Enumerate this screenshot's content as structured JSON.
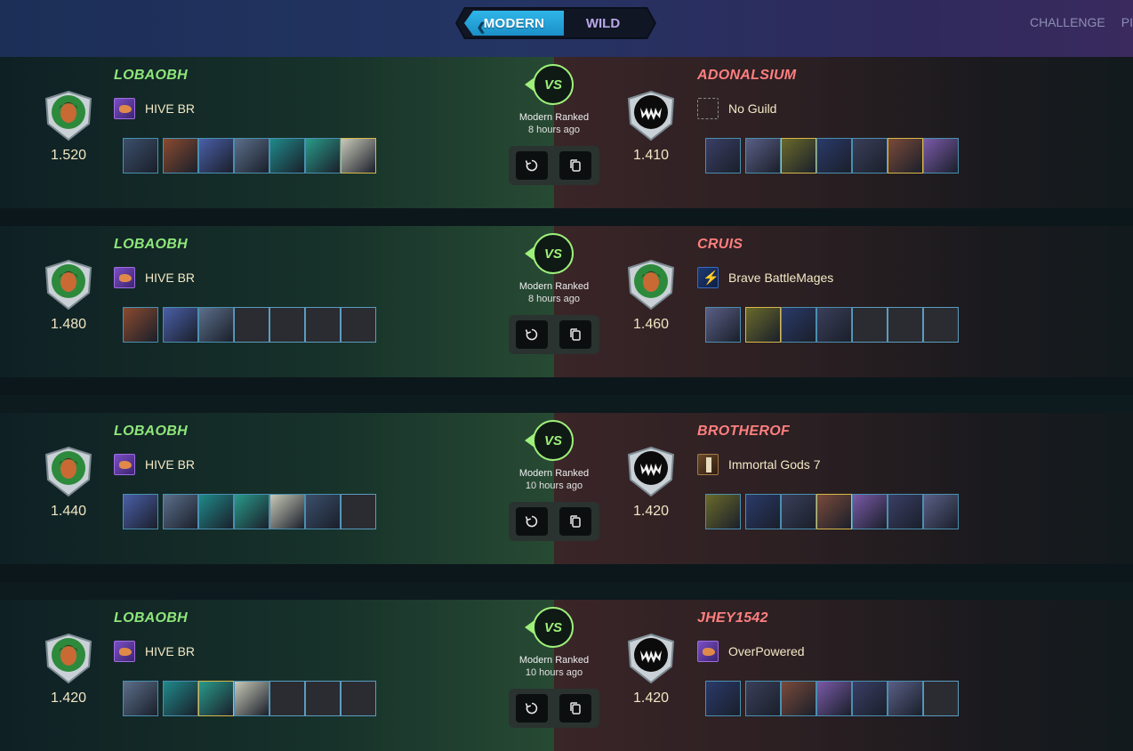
{
  "header": {
    "format_tabs": [
      {
        "label": "MODERN",
        "active": true
      },
      {
        "label": "WILD",
        "active": false
      }
    ],
    "nav": [
      "CHALLENGE",
      "PI"
    ]
  },
  "colors": {
    "winner_name": "#8fe67a",
    "loser_name": "#ff7f7f",
    "vs_accent": "#9ef07a",
    "active_tab": "#2fb6e8"
  },
  "battles": [
    {
      "left": {
        "name": "LOBAOBH",
        "guild": "HIVE BR",
        "guild_icon": "hive-br-icon",
        "rating": "1.520",
        "avatar": "ranger-shield-avatar",
        "cards": [
          "filled",
          "filled",
          "filled",
          "filled",
          "filled",
          "filled",
          "gold"
        ]
      },
      "right": {
        "name": "ADONALSIUM",
        "guild": "No Guild",
        "guild_icon": "no-guild-icon",
        "rating": "1.410",
        "avatar": "monster-shield-avatar",
        "cards": [
          "filled",
          "filled",
          "gold",
          "filled",
          "filled",
          "gold",
          "filled"
        ]
      },
      "match_type": "Modern Ranked",
      "time_ago": "8 hours ago"
    },
    {
      "left": {
        "name": "LOBAOBH",
        "guild": "HIVE BR",
        "guild_icon": "hive-br-icon",
        "rating": "1.480",
        "avatar": "ranger-shield-avatar",
        "cards": [
          "filled",
          "filled",
          "filled",
          "empty",
          "empty",
          "empty",
          "empty"
        ]
      },
      "right": {
        "name": "CRUIS",
        "guild": "Brave BattleMages",
        "guild_icon": "brave-battlemages-icon",
        "rating": "1.460",
        "avatar": "ranger-shield-avatar",
        "cards": [
          "filled",
          "gold",
          "filled",
          "filled",
          "empty",
          "empty",
          "empty"
        ]
      },
      "match_type": "Modern Ranked",
      "time_ago": "8 hours ago"
    },
    {
      "left": {
        "name": "LOBAOBH",
        "guild": "HIVE BR",
        "guild_icon": "hive-br-icon",
        "rating": "1.440",
        "avatar": "ranger-shield-avatar",
        "cards": [
          "filled",
          "filled",
          "filled",
          "filled",
          "filled",
          "filled",
          "empty"
        ]
      },
      "right": {
        "name": "BROTHEROF",
        "guild": "Immortal Gods 7",
        "guild_icon": "immortal-gods-icon",
        "rating": "1.420",
        "avatar": "monster-shield-avatar",
        "cards": [
          "filled",
          "filled",
          "filled",
          "gold",
          "filled",
          "filled",
          "filled"
        ]
      },
      "match_type": "Modern Ranked",
      "time_ago": "10 hours ago"
    },
    {
      "left": {
        "name": "LOBAOBH",
        "guild": "HIVE BR",
        "guild_icon": "hive-br-icon",
        "rating": "1.420",
        "avatar": "ranger-shield-avatar",
        "cards": [
          "filled",
          "filled",
          "gold",
          "filled",
          "empty",
          "empty",
          "empty"
        ]
      },
      "right": {
        "name": "JHEY1542",
        "guild": "OverPowered",
        "guild_icon": "overpowered-icon",
        "rating": "1.420",
        "avatar": "monster-shield-avatar",
        "cards": [
          "filled",
          "filled",
          "filled",
          "filled",
          "filled",
          "filled",
          "empty"
        ]
      },
      "match_type": "Modern Ranked",
      "time_ago": "10 hours ago"
    }
  ]
}
